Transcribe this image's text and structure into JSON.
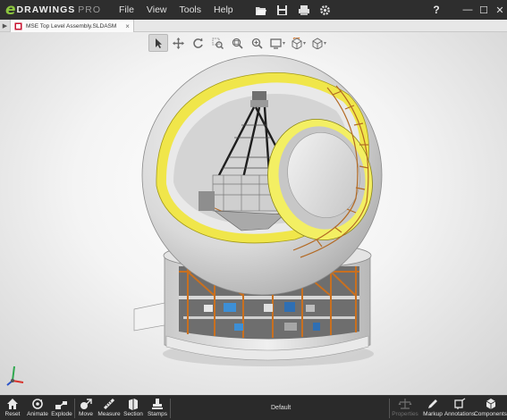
{
  "app": {
    "logo_e": "e",
    "logo_drawings": "DRAWINGS",
    "logo_pro": "PRO",
    "accent": "#8cc63f"
  },
  "menu": {
    "items": [
      "File",
      "View",
      "Tools",
      "Help"
    ]
  },
  "title_tools": [
    {
      "name": "open-file-icon"
    },
    {
      "name": "save-icon"
    },
    {
      "name": "print-icon"
    },
    {
      "name": "settings-icon"
    }
  ],
  "window": {
    "help": "?",
    "minimize": "—",
    "maximize": "☐",
    "close": "✕"
  },
  "tabs": [
    {
      "label": "MSE Top Level Assembly.SLDASM",
      "close": "×"
    }
  ],
  "view_toolbar": [
    {
      "name": "select-icon",
      "active": true
    },
    {
      "name": "pan-icon"
    },
    {
      "name": "rotate-icon"
    },
    {
      "name": "zoom-area-icon"
    },
    {
      "name": "zoom-to-fit-icon"
    },
    {
      "name": "zoom-in-out-icon"
    },
    {
      "name": "display-style-icon"
    },
    {
      "name": "view-orientation-icon"
    },
    {
      "name": "standard-views-icon"
    }
  ],
  "bottom_toolbar": {
    "left": [
      {
        "label": "Reset",
        "icon": "home-icon"
      },
      {
        "label": "Animate",
        "icon": "animate-icon"
      },
      {
        "label": "Explode",
        "icon": "explode-icon"
      },
      {
        "label": "Move",
        "icon": "move-icon"
      },
      {
        "label": "Measure",
        "icon": "measure-icon"
      },
      {
        "label": "Section",
        "icon": "section-icon"
      },
      {
        "label": "Stamps",
        "icon": "stamps-icon"
      }
    ],
    "configuration": "Default",
    "right": [
      {
        "label": "Properties",
        "icon": "properties-icon",
        "disabled": true
      },
      {
        "label": "Markup",
        "icon": "markup-icon"
      },
      {
        "label": "Annotations",
        "icon": "annotations-icon"
      },
      {
        "label": "Components",
        "icon": "components-icon"
      }
    ]
  },
  "triad": {
    "x_color": "#d8322b",
    "y_color": "#2fa84f",
    "z_color": "#2b54c8"
  }
}
